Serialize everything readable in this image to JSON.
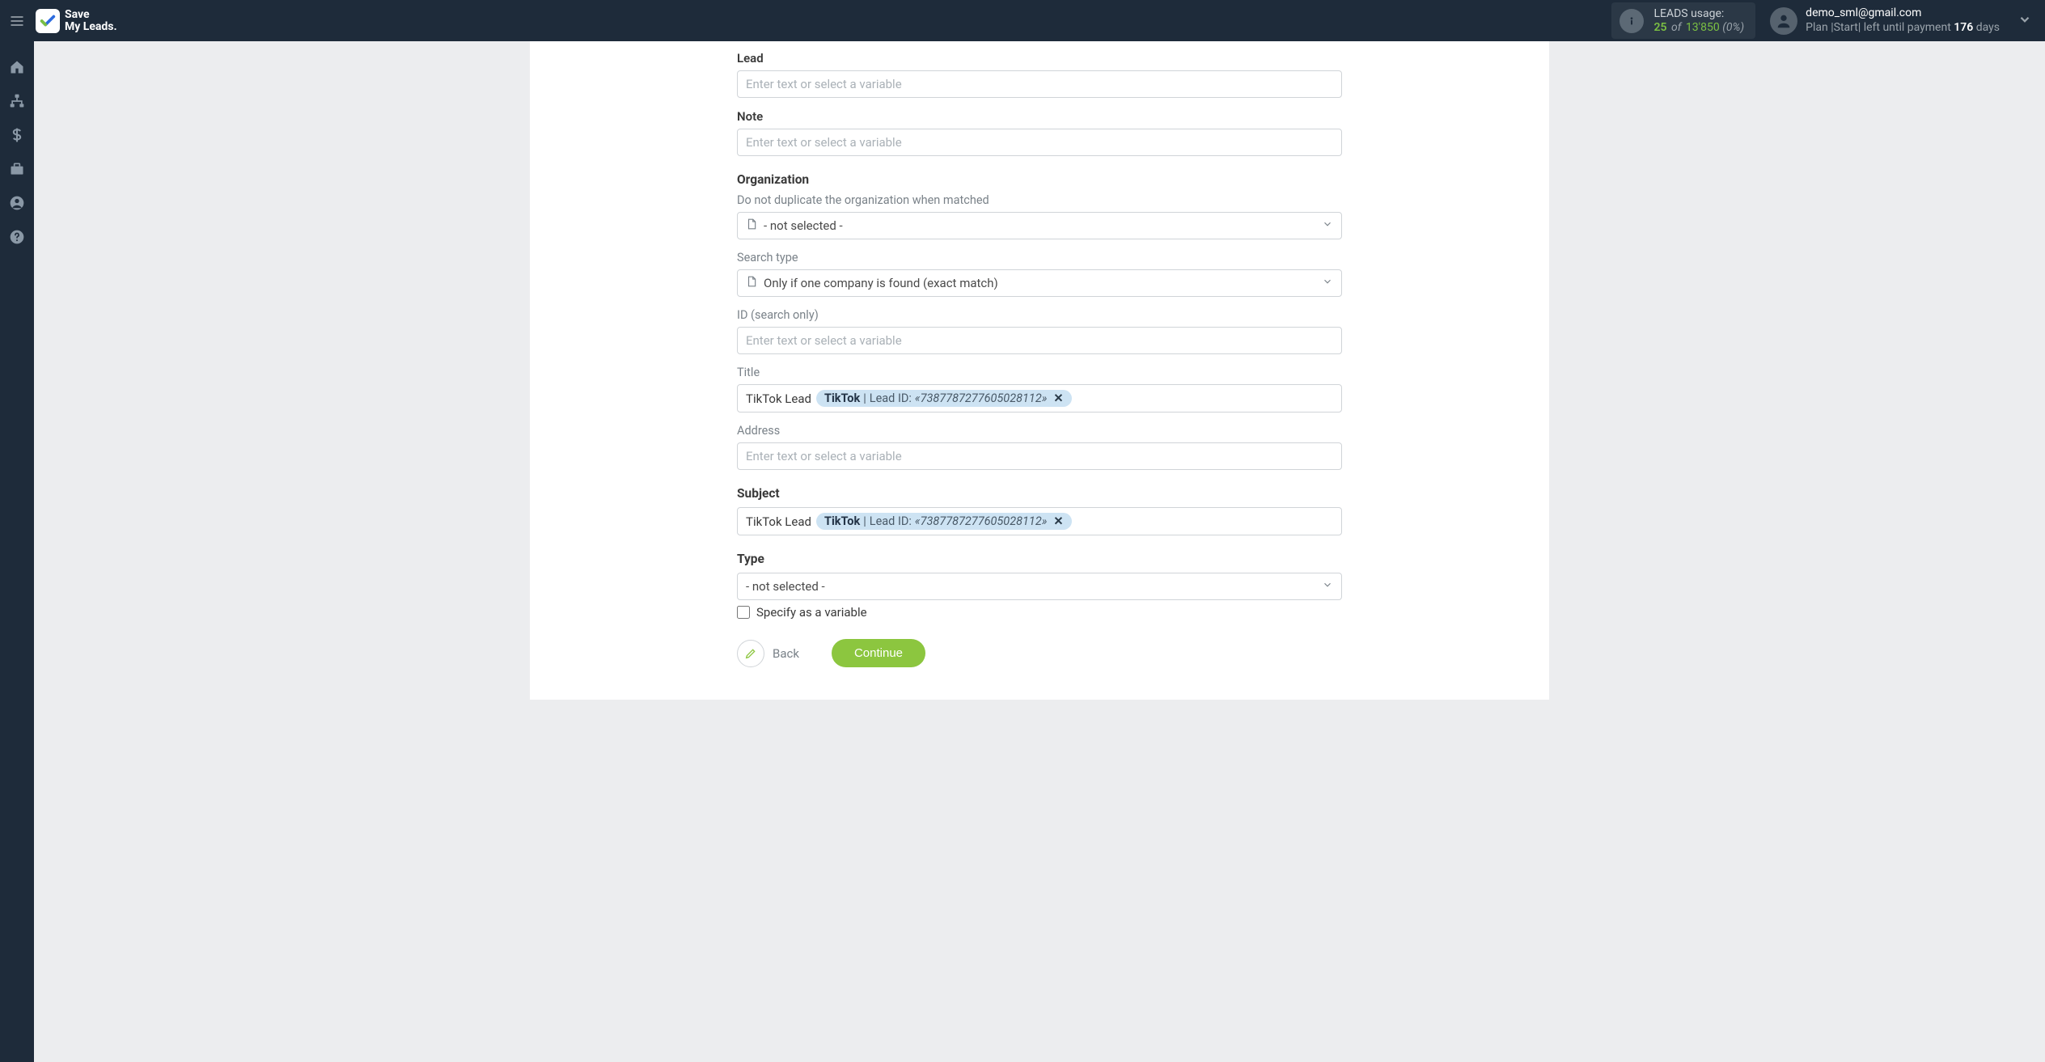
{
  "brand": {
    "line1": "Save",
    "line2": "My Leads."
  },
  "usage": {
    "label": "LEADS usage:",
    "used": "25",
    "of": "of",
    "total": "13'850",
    "pct": "(0%)"
  },
  "user": {
    "email": "demo_sml@gmail.com",
    "plan_prefix": "Plan |Start| left until payment ",
    "days_num": "176",
    "days_suffix": " days"
  },
  "form": {
    "lead": {
      "label": "Lead",
      "placeholder": "Enter text or select a variable"
    },
    "note": {
      "label": "Note",
      "placeholder": "Enter text or select a variable"
    },
    "org_section": "Organization",
    "dup": {
      "label": "Do not duplicate the organization when matched",
      "value": "- not selected -"
    },
    "search_type": {
      "label": "Search type",
      "value": "Only if one company is found (exact match)"
    },
    "id_search": {
      "label": "ID (search only)",
      "placeholder": "Enter text or select a variable"
    },
    "title": {
      "label": "Title",
      "prefix": "TikTok Lead",
      "pill_src": "TikTok",
      "pill_sep": " | ",
      "pill_label": "Lead ID: ",
      "pill_val": "«7387787277605028112»"
    },
    "address": {
      "label": "Address",
      "placeholder": "Enter text or select a variable"
    },
    "subject_section": "Subject",
    "subject": {
      "prefix": "TikTok Lead",
      "pill_src": "TikTok",
      "pill_sep": " | ",
      "pill_label": "Lead ID: ",
      "pill_val": "«7387787277605028112»"
    },
    "type_section": "Type",
    "type": {
      "value": "- not selected -"
    },
    "specify_var": "Specify as a variable",
    "back": "Back",
    "continue": "Continue"
  }
}
